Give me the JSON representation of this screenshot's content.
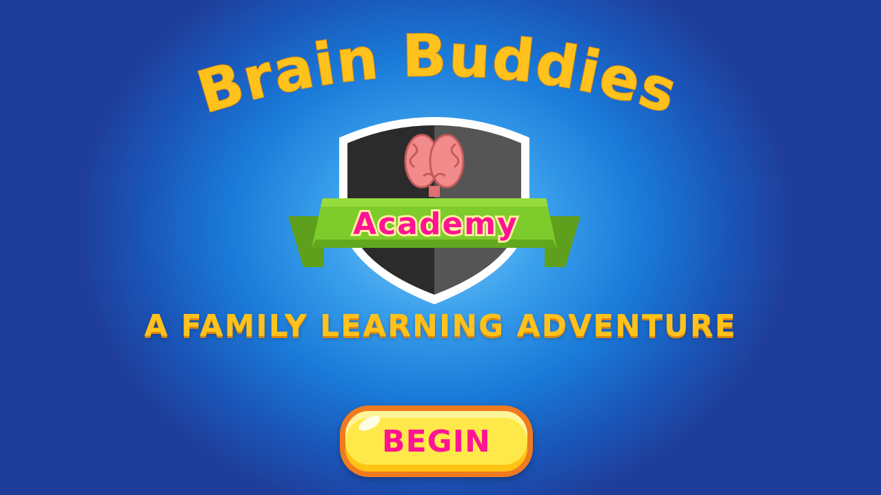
{
  "title": "Brain Buddies",
  "emblem": {
    "label": "Academy",
    "icon": "brain-icon"
  },
  "subtitle": "A Family Learning Adventure",
  "begin_button": {
    "label": "Begin"
  },
  "colors": {
    "title": "#ffc21c",
    "label_pink": "#ff1493",
    "ribbon_green": "#7ecb2c",
    "shield_dark": "#2b2b2b",
    "button_yellow": "#ffe94a",
    "button_border": "#f07a20"
  }
}
